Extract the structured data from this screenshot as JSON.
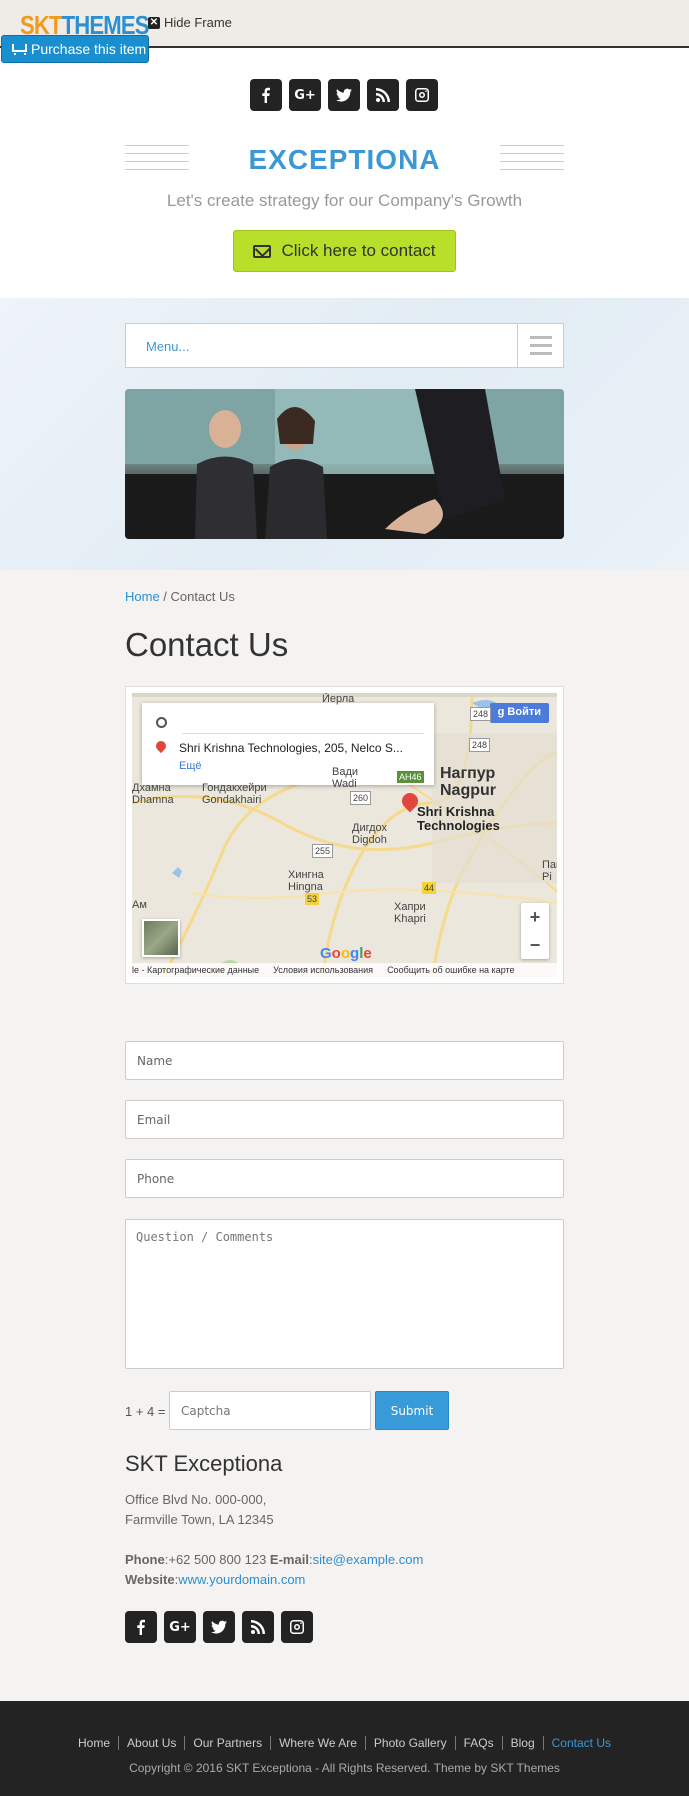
{
  "frame": {
    "logo_skt": "SKT",
    "logo_themes": "THEMES",
    "hide_frame": "Hide Frame",
    "purchase": "Purchase this item"
  },
  "header": {
    "site_title": "EXCEPTIONA",
    "tagline": "Let's create strategy for our Company's Growth",
    "cta": "Click here to contact",
    "social": [
      "facebook-icon",
      "google-plus-icon",
      "twitter-icon",
      "rss-icon",
      "instagram-icon"
    ]
  },
  "nav": {
    "menu_label": "Menu..."
  },
  "breadcrumb": {
    "home": "Home",
    "separator": " / ",
    "current": "Contact Us"
  },
  "page_title": "Contact Us",
  "map": {
    "address": "Shri Krishna Technologies, 205, Nelco S...",
    "more": "Ещё",
    "login": "Войти",
    "place_line1": "Shri Krishna",
    "place_line2": "Technologies",
    "city_ru": "Нагпур",
    "city_en": "Nagpur",
    "labels": {
      "yerla": "Йерла",
      "dhamna_ru": "Дхамна",
      "dhamna_en": "Dhamna",
      "gondkhairi_ru": "Гондакхейри",
      "gondkhairi_en": "Gondakhairi",
      "wadi_ru": "Вади",
      "wadi_en": "Wadi",
      "digdoh_ru": "Дигдох",
      "digdoh_en": "Digdoh",
      "hingna_ru": "Хингна",
      "hingna_en": "Hingna",
      "khapri_ru": "Хапри",
      "khapri_en": "Khapri",
      "pai_ru": "Пай",
      "pai_en": "Pi",
      "am": "Ам",
      "ah46": "AH46",
      "r248": "248",
      "r260": "260",
      "r255": "255",
      "r53": "53",
      "r44": "44"
    },
    "google": "Google",
    "footer": [
      "le - Картографические данные",
      "Условия использования",
      "Сообщить об ошибке на карте"
    ],
    "zoom_in": "+",
    "zoom_out": "−"
  },
  "form": {
    "name_placeholder": "Name",
    "email_placeholder": "Email",
    "phone_placeholder": "Phone",
    "comments_placeholder": "Question / Comments",
    "captcha_question": "1 + 4 =",
    "captcha_placeholder": "Captcha",
    "submit": "Submit"
  },
  "address": {
    "company": "SKT Exceptiona",
    "line1": "Office Blvd No. 000-000,",
    "line2": "Farmville Town, LA 12345",
    "phone_label": "Phone",
    "phone": ":+62 500 800 123 ",
    "email_label": "E-mail",
    "email": "site@example.com",
    "website_label": "Website",
    "website": "www.yourdomain.com"
  },
  "footer": {
    "links": [
      "Home",
      "About Us",
      "Our Partners",
      "Where We Are",
      "Photo Gallery",
      "FAQs",
      "Blog",
      "Contact Us"
    ],
    "copyright": "Copyright © 2016 SKT Exceptiona - All Rights Reserved. Theme by SKT Themes"
  }
}
